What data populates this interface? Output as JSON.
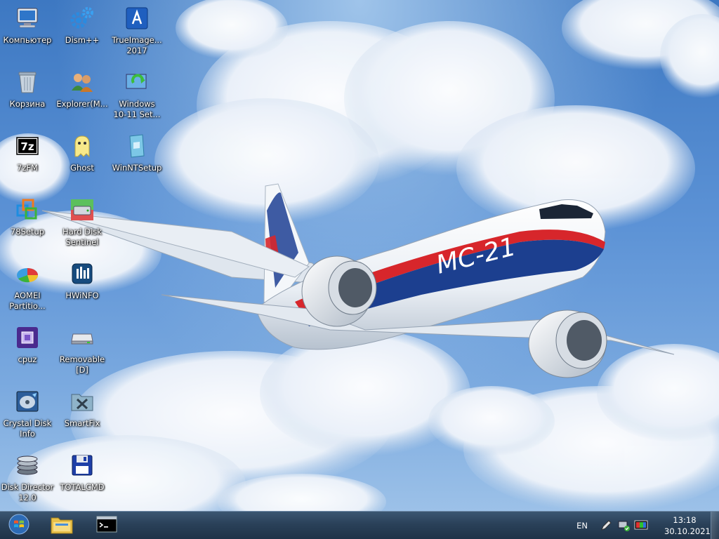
{
  "desktop": {
    "icons": [
      {
        "id": "computer",
        "label": "Компьютер",
        "icon": "computer-icon"
      },
      {
        "id": "dism",
        "label": "Dism++",
        "icon": "gears-icon"
      },
      {
        "id": "trueimage",
        "label": "TrueImage...\n2017",
        "icon": "acronis-icon"
      },
      {
        "id": "recycle",
        "label": "Корзина",
        "icon": "recycle-bin-icon"
      },
      {
        "id": "explorer",
        "label": "Explorer(M...",
        "icon": "users-icon"
      },
      {
        "id": "winsetup",
        "label": "Windows\n10-11 Set...",
        "icon": "windows-setup-icon"
      },
      {
        "id": "7zfm",
        "label": "7zFM",
        "icon": "7zip-icon"
      },
      {
        "id": "ghost",
        "label": "Ghost",
        "icon": "ghost-icon"
      },
      {
        "id": "winntsetup",
        "label": "WinNTSetup",
        "icon": "winntsetup-icon"
      },
      {
        "id": "78setup",
        "label": "78Setup",
        "icon": "windows-squares-icon"
      },
      {
        "id": "hdsentinel",
        "label": "Hard Disk\nSentinel",
        "icon": "hard-disk-icon"
      },
      {
        "id": "aomei",
        "label": "AOMEI\nPartitio...",
        "icon": "partition-icon"
      },
      {
        "id": "hwinfo",
        "label": "HWiNFO",
        "icon": "hwinfo-icon"
      },
      {
        "id": "cpuz",
        "label": "cpuz",
        "icon": "cpu-chip-icon"
      },
      {
        "id": "removable",
        "label": "Removable\n[D]",
        "icon": "removable-drive-icon"
      },
      {
        "id": "crystaldisk",
        "label": "Crystal Disk\nInfo",
        "icon": "crystal-disk-icon"
      },
      {
        "id": "smartfix",
        "label": "SmartFix",
        "icon": "tools-folder-icon"
      },
      {
        "id": "diskdirector",
        "label": "Disk Director\n12.0",
        "icon": "disk-stack-icon"
      },
      {
        "id": "totalcmd",
        "label": "TOTALCMD",
        "icon": "floppy-disk-icon"
      }
    ]
  },
  "wallpaper": {
    "aircraft_label": "MC-21"
  },
  "taskbar": {
    "start_icon": "windows-logo-icon",
    "apps": [
      {
        "id": "explorer",
        "icon": "folder-icon"
      },
      {
        "id": "cmd",
        "icon": "command-prompt-icon"
      }
    ],
    "language": "EN",
    "tray_icons": [
      "pen-icon",
      "network-icon",
      "display-icon"
    ],
    "time": "13:18",
    "date": "30.10.2021"
  },
  "colors": {
    "taskbar": "#2a4159",
    "sky": "#4a83c8",
    "accent_red": "#d7262b",
    "accent_blue": "#1c3f8f"
  }
}
